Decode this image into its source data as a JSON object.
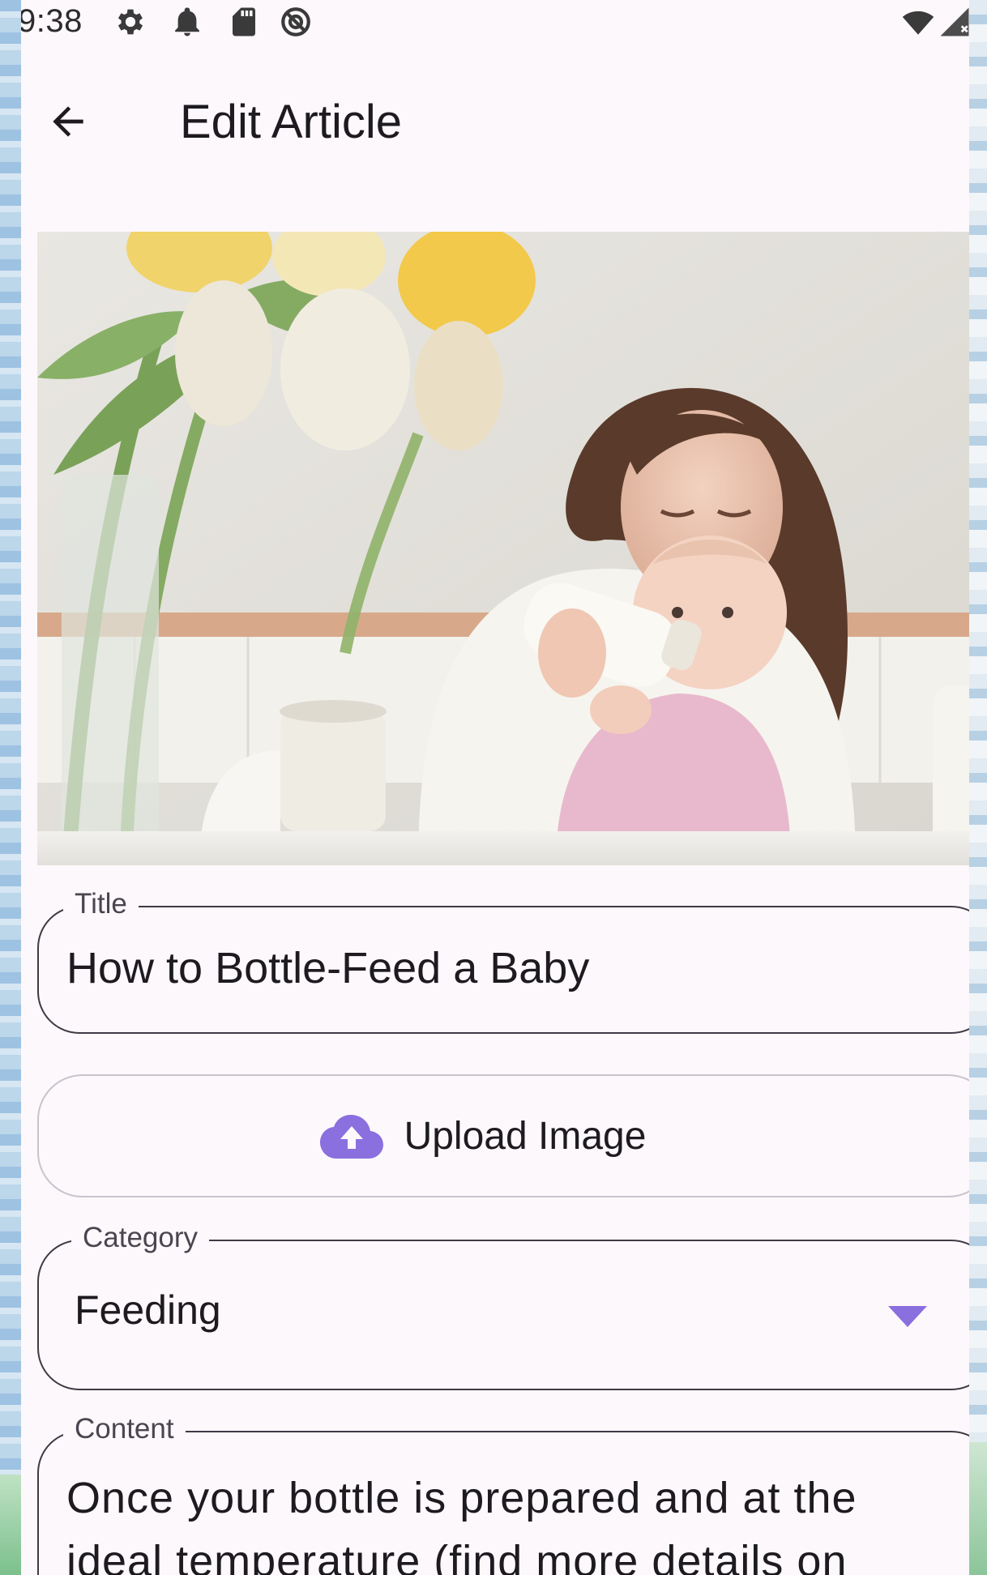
{
  "status_bar": {
    "time": "9:38",
    "icons": [
      "gear-icon",
      "bell-icon",
      "sd-card-icon",
      "do-not-disturb-icon",
      "wifi-icon",
      "signal-icon"
    ]
  },
  "app_bar": {
    "back_icon": "arrow-back-icon",
    "title": "Edit Article"
  },
  "hero_image": {
    "description_icon": "photo"
  },
  "form": {
    "title": {
      "label": "Title",
      "value": "How to Bottle-Feed a Baby"
    },
    "upload": {
      "icon": "cloud-upload-icon",
      "label": "Upload Image"
    },
    "category": {
      "label": "Category",
      "value": "Feeding",
      "icon": "dropdown-arrow-icon"
    },
    "content": {
      "label": "Content",
      "value": "Once your bottle is prepared and at the ideal temperature (find more details on"
    }
  },
  "colors": {
    "accent": "#8a6fdf",
    "surface": "#fdf8fc",
    "outline": "#3f3a44",
    "text": "#1d1b20"
  }
}
